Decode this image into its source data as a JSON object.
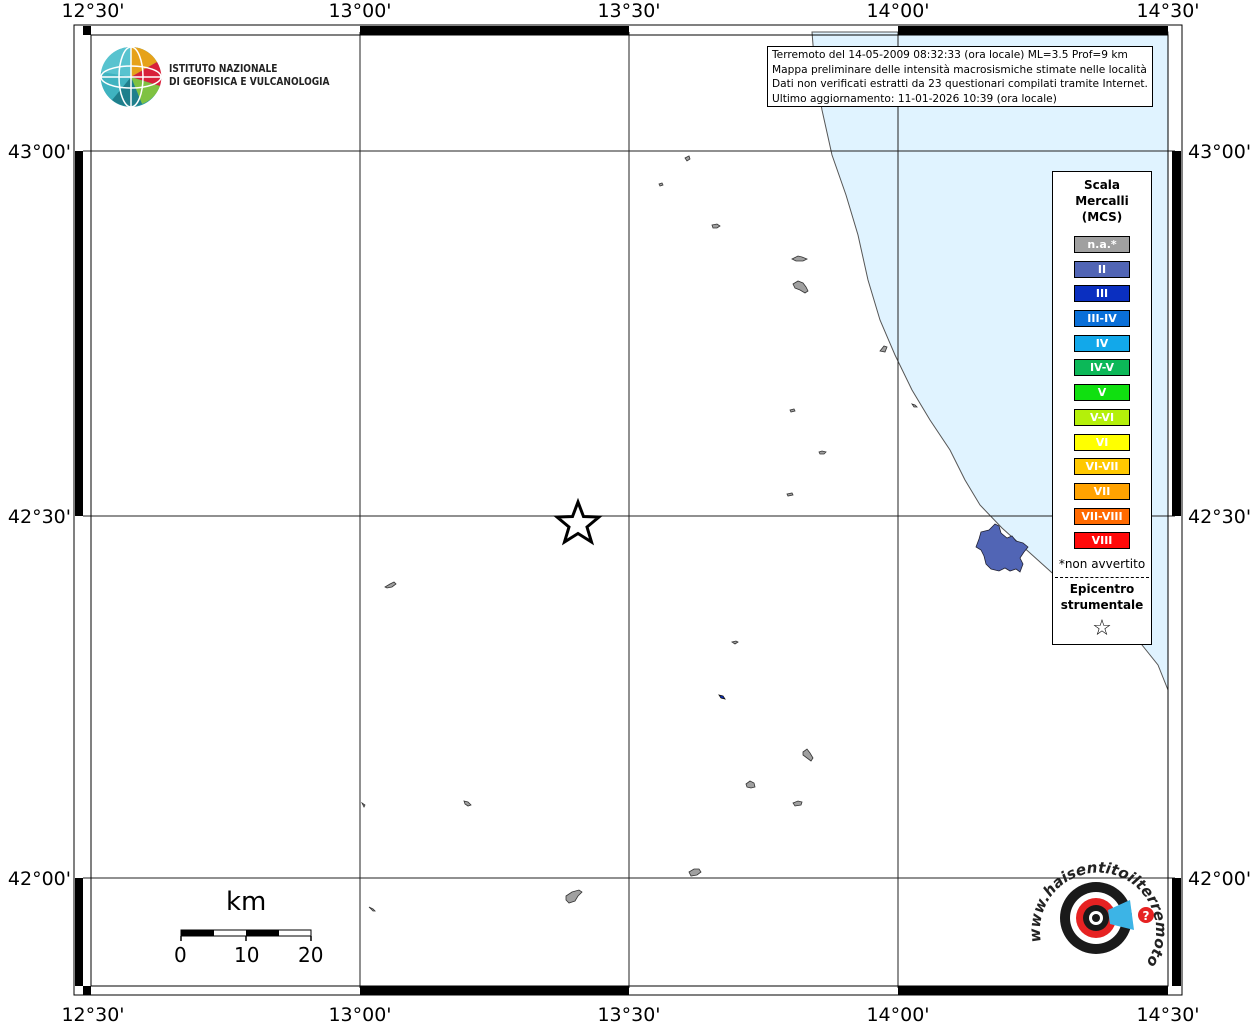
{
  "map": {
    "lon_labels": [
      "12°30'",
      "13°00'",
      "13°30'",
      "14°00'",
      "14°30'"
    ],
    "lat_labels": [
      "43°00'",
      "42°30'",
      "42°00'"
    ],
    "epicenter": {
      "lon": 13.38,
      "lat": 42.49
    }
  },
  "info": {
    "line1": "Terremoto del 14-05-2009 08:32:33 (ora locale) ML=3.5 Prof=9 km",
    "line2": "Mappa preliminare delle intensità macrosismiche stimate nelle località",
    "line3": "Dati non verificati estratti da 23 questionari compilati tramite Internet.",
    "line4": "Ultimo aggiornamento: 11-01-2026 10:39 (ora locale)"
  },
  "logo": {
    "line1": "ISTITUTO NAZIONALE",
    "line2": "DI GEOFISICA E VULCANOLOGIA"
  },
  "legend": {
    "title_line1": "Scala",
    "title_line2": "Mercalli",
    "title_line3": "(MCS)",
    "items": [
      {
        "label": "n.a.*",
        "color": "#a0a0a0"
      },
      {
        "label": "II",
        "color": "#5165b5"
      },
      {
        "label": "III",
        "color": "#0a2fc0"
      },
      {
        "label": "III-IV",
        "color": "#0a6fd8"
      },
      {
        "label": "IV",
        "color": "#12a8ea"
      },
      {
        "label": "IV-V",
        "color": "#0cb858"
      },
      {
        "label": "V",
        "color": "#10e010"
      },
      {
        "label": "V-VI",
        "color": "#b4f00a"
      },
      {
        "label": "VI",
        "color": "#ffff00"
      },
      {
        "label": "VI-VII",
        "color": "#ffc800"
      },
      {
        "label": "VII",
        "color": "#ffa200"
      },
      {
        "label": "VII-VIII",
        "color": "#ff6a00"
      },
      {
        "label": "VIII",
        "color": "#ff0a0a"
      }
    ],
    "note": "*non avvertito",
    "epi_line1": "Epicentro",
    "epi_line2": "strumentale",
    "epi_symbol": "☆"
  },
  "scale_bar": {
    "unit": "km",
    "labels": [
      "0",
      "10",
      "20"
    ]
  },
  "colors": {
    "sea": "#e0f3ff",
    "locality": "#a0a0a0",
    "intensity_ii": "#5165b5"
  },
  "badge": {
    "text": "www.haisentitoilterremoto.it"
  }
}
